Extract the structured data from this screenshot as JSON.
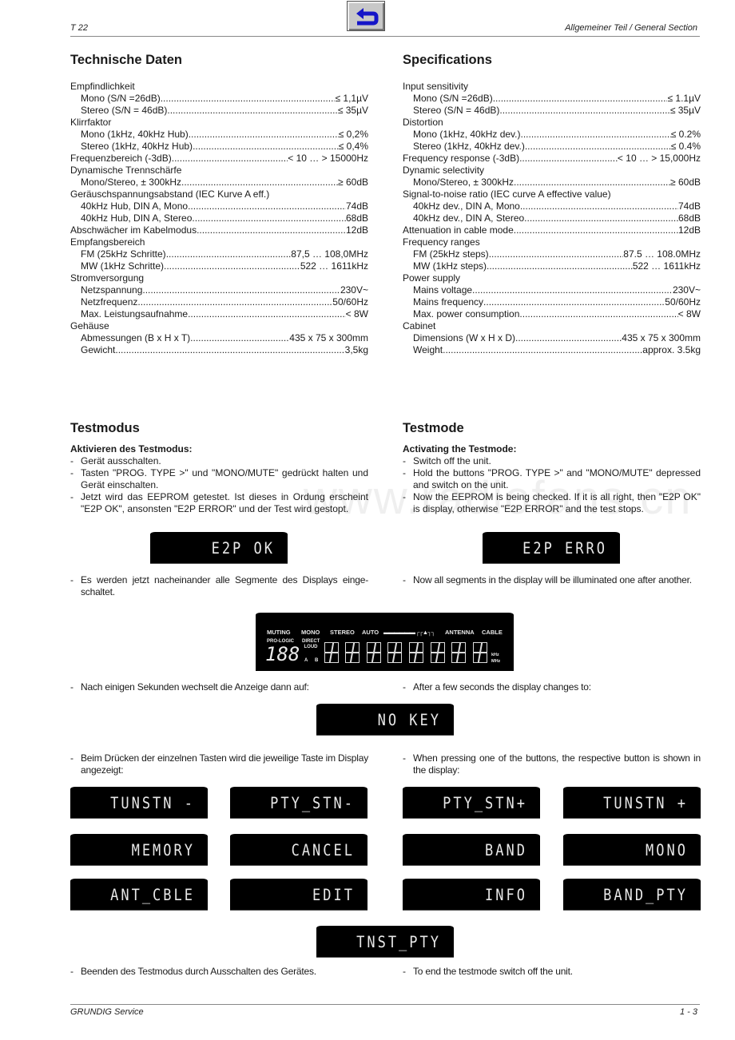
{
  "header": {
    "model": "T 22",
    "section": "Allgemeiner Teil / General Section",
    "back_button_icon": "return-arrow-icon"
  },
  "footer": {
    "brand": "GRUNDIG Service",
    "page": "1 - 3"
  },
  "specs_de": {
    "title": "Technische Daten",
    "groups": [
      {
        "cat": "Empfindlichkeit",
        "rows": [
          {
            "label": "Mono (S/N =26dB)",
            "value": "≤ 1,1µV"
          },
          {
            "label": "Stereo (S/N = 46dB)",
            "value": "≤ 35µV"
          }
        ]
      },
      {
        "cat": "Klirrfaktor",
        "rows": [
          {
            "label": "Mono (1kHz, 40kHz Hub)",
            "value": "≤ 0,2%"
          },
          {
            "label": "Stereo (1kHz, 40kHz Hub)",
            "value": "≤ 0,4%"
          }
        ]
      },
      {
        "cat": "",
        "rows": [],
        "inline": {
          "label": "Frequenzbereich (-3dB)",
          "value": "< 10 … > 15000Hz"
        }
      },
      {
        "cat": "Dynamische Trennschärfe",
        "rows": [
          {
            "label": "Mono/Stereo, ± 300kHz",
            "value": "≥ 60dB"
          }
        ]
      },
      {
        "cat": "Geräuschspannungsabstand (IEC Kurve A eff.)",
        "rows": [
          {
            "label": "40kHz Hub, DIN A, Mono",
            "value": "74dB"
          },
          {
            "label": "40kHz Hub, DIN A, Stereo",
            "value": "68dB"
          }
        ]
      },
      {
        "cat": "",
        "rows": [],
        "inline": {
          "label": "Abschwächer im Kabelmodus",
          "value": "12dB"
        }
      },
      {
        "cat": "Empfangsbereich",
        "rows": [
          {
            "label": "FM (25kHz Schritte)",
            "value": "87,5 … 108,0MHz"
          },
          {
            "label": "MW (1kHz Schritte)",
            "value": "522 … 1611kHz"
          }
        ]
      },
      {
        "cat": "Stromversorgung",
        "rows": [
          {
            "label": "Netzspannung",
            "value": "230V~"
          },
          {
            "label": "Netzfrequenz",
            "value": "50/60Hz"
          },
          {
            "label": "Max. Leistungsaufnahme",
            "value": "< 8W"
          }
        ]
      },
      {
        "cat": "Gehäuse",
        "rows": [
          {
            "label": "Abmessungen (B x H x T)",
            "value": "435 x 75 x 300mm"
          },
          {
            "label": "Gewicht",
            "value": "3,5kg"
          }
        ]
      }
    ]
  },
  "specs_en": {
    "title": "Specifications",
    "groups": [
      {
        "cat": "Input sensitivity",
        "rows": [
          {
            "label": "Mono (S/N =26dB)",
            "value": "≤ 1.1µV"
          },
          {
            "label": "Stereo (S/N = 46dB)",
            "value": "≤ 35µV"
          }
        ]
      },
      {
        "cat": "Distortion",
        "rows": [
          {
            "label": "Mono (1kHz, 40kHz dev.)",
            "value": "≤ 0.2%"
          },
          {
            "label": "Stereo (1kHz, 40kHz dev.)",
            "value": "≤ 0.4%"
          }
        ]
      },
      {
        "cat": "",
        "rows": [],
        "inline": {
          "label": "Frequency response (-3dB)",
          "value": "< 10 … > 15,000Hz"
        }
      },
      {
        "cat": "Dynamic selectivity",
        "rows": [
          {
            "label": "Mono/Stereo, ± 300kHz",
            "value": "≥ 60dB"
          }
        ]
      },
      {
        "cat": "Signal-to-noise ratio (IEC curve A effective value)",
        "rows": [
          {
            "label": "40kHz dev., DIN A, Mono",
            "value": "74dB"
          },
          {
            "label": "40kHz dev., DIN A, Stereo",
            "value": "68dB"
          }
        ]
      },
      {
        "cat": "",
        "rows": [],
        "inline": {
          "label": "Attenuation in cable mode",
          "value": "12dB"
        }
      },
      {
        "cat": "Frequency ranges",
        "rows": [
          {
            "label": "FM (25kHz steps)",
            "value": "87.5 … 108.0MHz"
          },
          {
            "label": "MW (1kHz steps)",
            "value": "522 … 1611kHz"
          }
        ]
      },
      {
        "cat": "Power supply",
        "rows": [
          {
            "label": "Mains voltage",
            "value": "230V~"
          },
          {
            "label": "Mains frequency",
            "value": "50/60Hz"
          },
          {
            "label": "Max. power consumption",
            "value": "< 8W"
          }
        ]
      },
      {
        "cat": "Cabinet",
        "rows": [
          {
            "label": "Dimensions (W x H x D)",
            "value": "435 x 75 x 300mm"
          },
          {
            "label": "Weight",
            "value": "approx. 3.5kg"
          }
        ]
      }
    ]
  },
  "test_de": {
    "title": "Testmodus",
    "subtitle": "Aktivieren des Testmodus:",
    "steps": [
      "Gerät ausschalten.",
      "Tasten \"PROG. TYPE >\" und \"MONO/MUTE\" gedrückt halten und Gerät einschalten.",
      "Jetzt wird das EEPROM getestet. Ist dieses in Ordung erscheint \"E2P OK\", ansonsten \"E2P ERROR\" und der Test wird gestopt."
    ],
    "segments_note": "Es werden jetzt nacheinander alle Segmente des Displays einge-schaltet.",
    "after_note": "Nach einigen Sekunden wechselt die Anzeige dann auf:",
    "press_note": "Beim Drücken der einzelnen Tasten wird die jeweilige Taste im Display angezeigt:",
    "end_note": "Beenden des Testmodus durch Ausschalten des Gerätes."
  },
  "test_en": {
    "title": "Testmode",
    "subtitle": "Activating the Testmode:",
    "steps": [
      "Switch off the unit.",
      "Hold the buttons \"PROG. TYPE >\" and \"MONO/MUTE\" depressed and switch on the unit.",
      "Now the EEPROM is being checked. If it is all right, then \"E2P OK\" is display, otherwise \"E2P ERROR\" and the test stops."
    ],
    "segments_note": "Now all segments in the display will be illuminated one after another.",
    "after_note": "After a few seconds the display changes to:",
    "press_note": "When pressing one of the buttons, the respective button is shown in the display:",
    "end_note": "To end the testmode switch off the unit."
  },
  "displays": {
    "e2p_ok": "E2P OK",
    "e2p_error": "E2P ERRO",
    "no_key": "NO KEY",
    "buttons": [
      "TUNSTN -",
      "PTY_STN-",
      "PTY_STN+",
      "TUNSTN +",
      "MEMORY",
      "CANCEL",
      "BAND",
      "MONO",
      "ANT_CBLE",
      "EDIT",
      "INFO",
      "BAND_PTY"
    ],
    "last": "TNST_PTY"
  },
  "full_display": {
    "indicators": [
      "MUTING",
      "MONO",
      "STEREO",
      "AUTO",
      "ANTENNA",
      "CABLE"
    ],
    "pro_logic": "PRO-LOGIC",
    "digits": "188",
    "direct_loud": "DIRECT LOUD",
    "ab": [
      "A",
      "B"
    ],
    "units": [
      "kHz",
      "MHz"
    ]
  },
  "watermark": "www.radiofans.cn"
}
